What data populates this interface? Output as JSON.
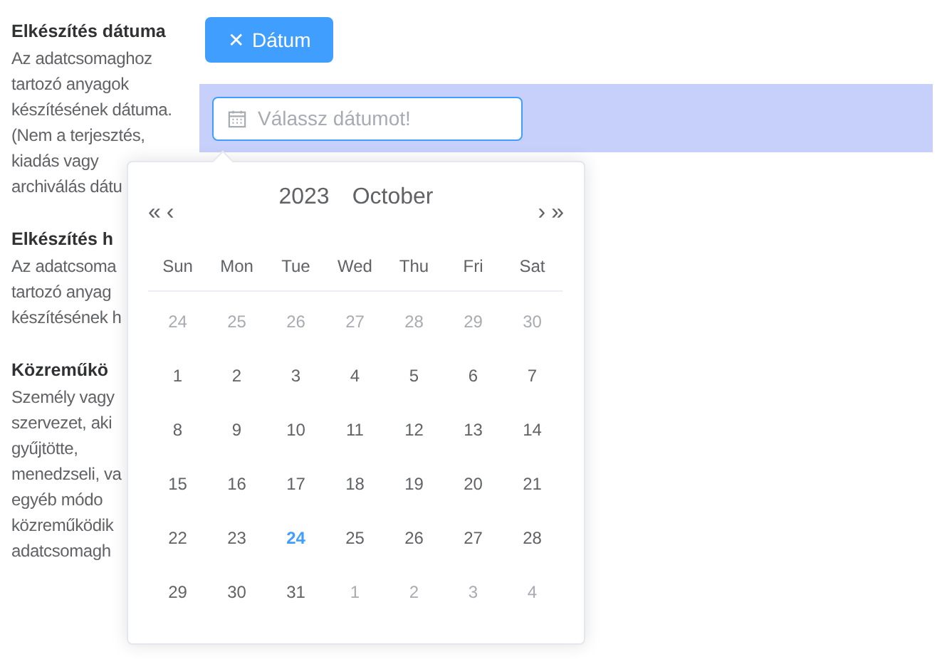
{
  "fields": [
    {
      "title": "Elkészítés dátuma",
      "lines": [
        "Az adatcsomaghoz",
        "tartozó anyagok",
        "készítésének dátuma.",
        "(Nem a terjesztés,",
        "kiadás vagy",
        "archiválás dátu"
      ]
    },
    {
      "title": "Elkészítés h",
      "lines": [
        "Az adatcsoma",
        "tartozó anyag",
        "készítésének h"
      ]
    },
    {
      "title": "Közreműkö",
      "lines": [
        "Személy vagy",
        "szervezet, aki",
        "gyűjtötte,",
        "menedzseli, va",
        "egyéb módo",
        "közreműködik",
        "adatcsomagh"
      ]
    }
  ],
  "date_button": {
    "icon": "✕",
    "label": "Dátum"
  },
  "date_input": {
    "placeholder": "Válassz dátumot!"
  },
  "calendar": {
    "nav": {
      "prev_year": "«",
      "prev_month": "‹",
      "next_month": "›",
      "next_year": "»"
    },
    "year": "2023",
    "month": "October",
    "weekdays": [
      "Sun",
      "Mon",
      "Tue",
      "Wed",
      "Thu",
      "Fri",
      "Sat"
    ],
    "weeks": [
      [
        {
          "day": "24",
          "muted": true,
          "today": false
        },
        {
          "day": "25",
          "muted": true,
          "today": false
        },
        {
          "day": "26",
          "muted": true,
          "today": false
        },
        {
          "day": "27",
          "muted": true,
          "today": false
        },
        {
          "day": "28",
          "muted": true,
          "today": false
        },
        {
          "day": "29",
          "muted": true,
          "today": false
        },
        {
          "day": "30",
          "muted": true,
          "today": false
        }
      ],
      [
        {
          "day": "1",
          "muted": false,
          "today": false
        },
        {
          "day": "2",
          "muted": false,
          "today": false
        },
        {
          "day": "3",
          "muted": false,
          "today": false
        },
        {
          "day": "4",
          "muted": false,
          "today": false
        },
        {
          "day": "5",
          "muted": false,
          "today": false
        },
        {
          "day": "6",
          "muted": false,
          "today": false
        },
        {
          "day": "7",
          "muted": false,
          "today": false
        }
      ],
      [
        {
          "day": "8",
          "muted": false,
          "today": false
        },
        {
          "day": "9",
          "muted": false,
          "today": false
        },
        {
          "day": "10",
          "muted": false,
          "today": false
        },
        {
          "day": "11",
          "muted": false,
          "today": false
        },
        {
          "day": "12",
          "muted": false,
          "today": false
        },
        {
          "day": "13",
          "muted": false,
          "today": false
        },
        {
          "day": "14",
          "muted": false,
          "today": false
        }
      ],
      [
        {
          "day": "15",
          "muted": false,
          "today": false
        },
        {
          "day": "16",
          "muted": false,
          "today": false
        },
        {
          "day": "17",
          "muted": false,
          "today": false
        },
        {
          "day": "18",
          "muted": false,
          "today": false
        },
        {
          "day": "19",
          "muted": false,
          "today": false
        },
        {
          "day": "20",
          "muted": false,
          "today": false
        },
        {
          "day": "21",
          "muted": false,
          "today": false
        }
      ],
      [
        {
          "day": "22",
          "muted": false,
          "today": false
        },
        {
          "day": "23",
          "muted": false,
          "today": false
        },
        {
          "day": "24",
          "muted": false,
          "today": true
        },
        {
          "day": "25",
          "muted": false,
          "today": false
        },
        {
          "day": "26",
          "muted": false,
          "today": false
        },
        {
          "day": "27",
          "muted": false,
          "today": false
        },
        {
          "day": "28",
          "muted": false,
          "today": false
        }
      ],
      [
        {
          "day": "29",
          "muted": false,
          "today": false
        },
        {
          "day": "30",
          "muted": false,
          "today": false
        },
        {
          "day": "31",
          "muted": false,
          "today": false
        },
        {
          "day": "1",
          "muted": true,
          "today": false
        },
        {
          "day": "2",
          "muted": true,
          "today": false
        },
        {
          "day": "3",
          "muted": true,
          "today": false
        },
        {
          "day": "4",
          "muted": true,
          "today": false
        }
      ]
    ]
  }
}
